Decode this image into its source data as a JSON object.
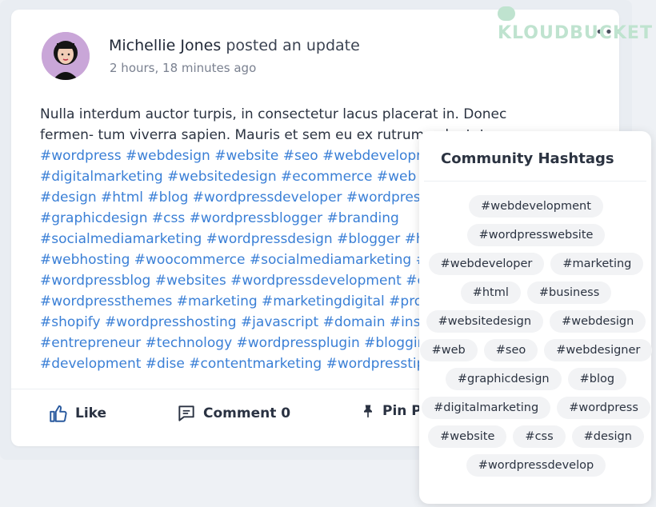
{
  "post": {
    "author": "Michellie Jones",
    "action": "posted an update",
    "timestamp": "2 hours, 18 minutes ago",
    "more_icon": "•••",
    "body_text": "Nulla interdum auctor turpis, in consectetur lacus placerat in. Donec fermen- tum viverra sapien. Mauris et sem eu ex rutrum vulputate.",
    "hashtags": "#wordpress #webdesign #website #seo #webdevelopment #digitalmarketing #websitedesign #ecommerce #web #webdeveloper #design #html #blog #wordpressdeveloper #wordpresswebsite #graphicdesign #css #wordpressblogger #branding #socialmediamarketing #wordpressdesign #blogger #hosting #php #webhosting #woocommerce #socialmediamarketing #wordpresstheme #wordpressblog #websites #wordpressdevelopment #coding #developer #wordpressthemes #marketing #marketingdigital #programming #shopify #wordpresshosting #javascript #domain #instagram #ux #entrepreneur #technology #wordpressplugin #blogging #uidesign #development #dise #contentmarketing #wordpresstips #smallbusiness"
  },
  "actions": {
    "like": "Like",
    "comment": "Comment 0",
    "pin": "Pin Post"
  },
  "watermark": "KLOUDBUCKET",
  "hashtag_panel": {
    "title": "Community Hashtags",
    "rows": [
      [
        "#webdevelopment"
      ],
      [
        "#wordpresswebsite"
      ],
      [
        "#webdeveloper",
        "#marketing"
      ],
      [
        "#html",
        "#business"
      ],
      [
        "#websitedesign",
        "#webdesign"
      ],
      [
        "#web",
        "#seo",
        "#webdesigner"
      ],
      [
        "#graphicdesign",
        "#blog"
      ],
      [
        "#digitalmarketing",
        "#wordpress"
      ],
      [
        "#website",
        "#css",
        "#design"
      ],
      [
        "#wordpressdevelop"
      ]
    ]
  },
  "colors": {
    "hashtag_link": "#3a7fd6",
    "text": "#2b3341",
    "chip_bg": "#f2f3f5"
  }
}
